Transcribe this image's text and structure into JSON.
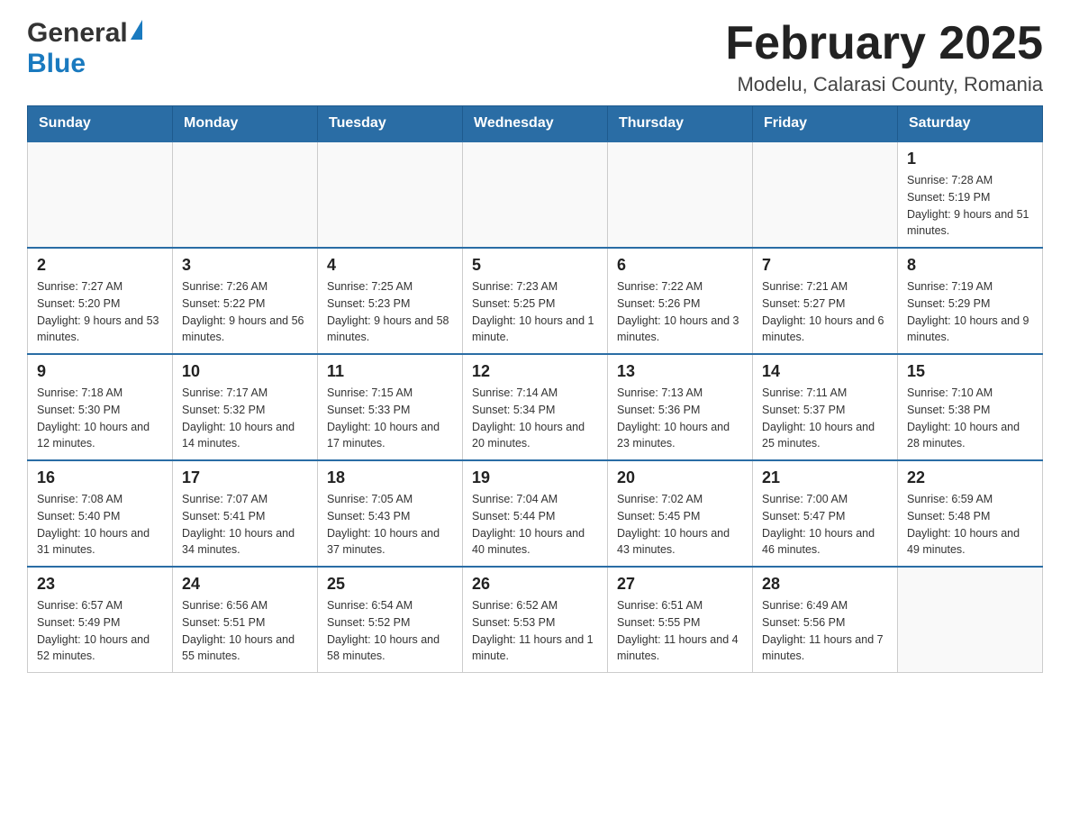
{
  "header": {
    "logo_general": "General",
    "logo_blue": "Blue",
    "title": "February 2025",
    "subtitle": "Modelu, Calarasi County, Romania"
  },
  "calendar": {
    "days_of_week": [
      "Sunday",
      "Monday",
      "Tuesday",
      "Wednesday",
      "Thursday",
      "Friday",
      "Saturday"
    ],
    "weeks": [
      {
        "days": [
          {
            "number": "",
            "info": ""
          },
          {
            "number": "",
            "info": ""
          },
          {
            "number": "",
            "info": ""
          },
          {
            "number": "",
            "info": ""
          },
          {
            "number": "",
            "info": ""
          },
          {
            "number": "",
            "info": ""
          },
          {
            "number": "1",
            "info": "Sunrise: 7:28 AM\nSunset: 5:19 PM\nDaylight: 9 hours and 51 minutes."
          }
        ]
      },
      {
        "days": [
          {
            "number": "2",
            "info": "Sunrise: 7:27 AM\nSunset: 5:20 PM\nDaylight: 9 hours and 53 minutes."
          },
          {
            "number": "3",
            "info": "Sunrise: 7:26 AM\nSunset: 5:22 PM\nDaylight: 9 hours and 56 minutes."
          },
          {
            "number": "4",
            "info": "Sunrise: 7:25 AM\nSunset: 5:23 PM\nDaylight: 9 hours and 58 minutes."
          },
          {
            "number": "5",
            "info": "Sunrise: 7:23 AM\nSunset: 5:25 PM\nDaylight: 10 hours and 1 minute."
          },
          {
            "number": "6",
            "info": "Sunrise: 7:22 AM\nSunset: 5:26 PM\nDaylight: 10 hours and 3 minutes."
          },
          {
            "number": "7",
            "info": "Sunrise: 7:21 AM\nSunset: 5:27 PM\nDaylight: 10 hours and 6 minutes."
          },
          {
            "number": "8",
            "info": "Sunrise: 7:19 AM\nSunset: 5:29 PM\nDaylight: 10 hours and 9 minutes."
          }
        ]
      },
      {
        "days": [
          {
            "number": "9",
            "info": "Sunrise: 7:18 AM\nSunset: 5:30 PM\nDaylight: 10 hours and 12 minutes."
          },
          {
            "number": "10",
            "info": "Sunrise: 7:17 AM\nSunset: 5:32 PM\nDaylight: 10 hours and 14 minutes."
          },
          {
            "number": "11",
            "info": "Sunrise: 7:15 AM\nSunset: 5:33 PM\nDaylight: 10 hours and 17 minutes."
          },
          {
            "number": "12",
            "info": "Sunrise: 7:14 AM\nSunset: 5:34 PM\nDaylight: 10 hours and 20 minutes."
          },
          {
            "number": "13",
            "info": "Sunrise: 7:13 AM\nSunset: 5:36 PM\nDaylight: 10 hours and 23 minutes."
          },
          {
            "number": "14",
            "info": "Sunrise: 7:11 AM\nSunset: 5:37 PM\nDaylight: 10 hours and 25 minutes."
          },
          {
            "number": "15",
            "info": "Sunrise: 7:10 AM\nSunset: 5:38 PM\nDaylight: 10 hours and 28 minutes."
          }
        ]
      },
      {
        "days": [
          {
            "number": "16",
            "info": "Sunrise: 7:08 AM\nSunset: 5:40 PM\nDaylight: 10 hours and 31 minutes."
          },
          {
            "number": "17",
            "info": "Sunrise: 7:07 AM\nSunset: 5:41 PM\nDaylight: 10 hours and 34 minutes."
          },
          {
            "number": "18",
            "info": "Sunrise: 7:05 AM\nSunset: 5:43 PM\nDaylight: 10 hours and 37 minutes."
          },
          {
            "number": "19",
            "info": "Sunrise: 7:04 AM\nSunset: 5:44 PM\nDaylight: 10 hours and 40 minutes."
          },
          {
            "number": "20",
            "info": "Sunrise: 7:02 AM\nSunset: 5:45 PM\nDaylight: 10 hours and 43 minutes."
          },
          {
            "number": "21",
            "info": "Sunrise: 7:00 AM\nSunset: 5:47 PM\nDaylight: 10 hours and 46 minutes."
          },
          {
            "number": "22",
            "info": "Sunrise: 6:59 AM\nSunset: 5:48 PM\nDaylight: 10 hours and 49 minutes."
          }
        ]
      },
      {
        "days": [
          {
            "number": "23",
            "info": "Sunrise: 6:57 AM\nSunset: 5:49 PM\nDaylight: 10 hours and 52 minutes."
          },
          {
            "number": "24",
            "info": "Sunrise: 6:56 AM\nSunset: 5:51 PM\nDaylight: 10 hours and 55 minutes."
          },
          {
            "number": "25",
            "info": "Sunrise: 6:54 AM\nSunset: 5:52 PM\nDaylight: 10 hours and 58 minutes."
          },
          {
            "number": "26",
            "info": "Sunrise: 6:52 AM\nSunset: 5:53 PM\nDaylight: 11 hours and 1 minute."
          },
          {
            "number": "27",
            "info": "Sunrise: 6:51 AM\nSunset: 5:55 PM\nDaylight: 11 hours and 4 minutes."
          },
          {
            "number": "28",
            "info": "Sunrise: 6:49 AM\nSunset: 5:56 PM\nDaylight: 11 hours and 7 minutes."
          },
          {
            "number": "",
            "info": ""
          }
        ]
      }
    ]
  }
}
